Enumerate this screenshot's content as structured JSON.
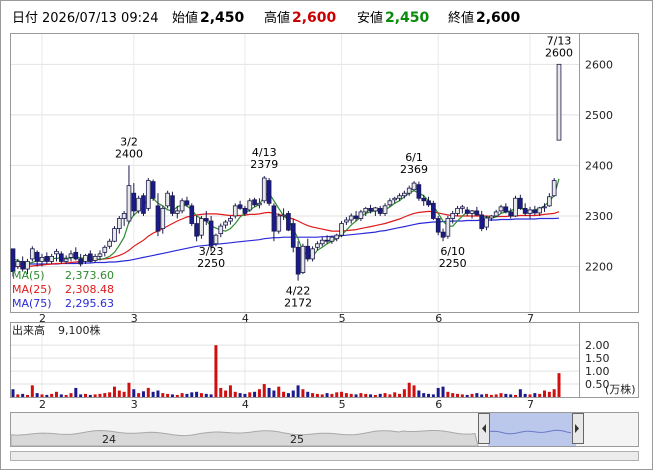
{
  "header": {
    "date_label": "日付",
    "date_value": "2026/07/13 09:24",
    "open_label": "始値",
    "open_value": "2,450",
    "high_label": "高値",
    "high_value": "2,600",
    "low_label": "安値",
    "low_value": "2,450",
    "close_label": "終値",
    "close_value": "2,600"
  },
  "colors": {
    "up": "#e8e8e8",
    "down": "#1a1a8c",
    "ma5": "#2e8b2e",
    "ma25": "#e01a1a",
    "ma75": "#2a2ad8",
    "high": "#cc0000",
    "low": "#0a8a0a",
    "vol_down": "#1a1a8c",
    "vol_up": "#d01010",
    "nav_fill": "#a8b8e8"
  },
  "legend": {
    "ma5_label": "MA(5)",
    "ma5_value": "2,373.60",
    "ma25_label": "MA(25)",
    "ma25_value": "2,308.48",
    "ma75_label": "MA(75)",
    "ma75_value": "2,295.63"
  },
  "volume_panel": {
    "label": "出来高",
    "value": "9,100株",
    "ticks": [
      "2.00",
      "1.50",
      "1.00",
      "0.50"
    ],
    "unit": "(万株)"
  },
  "navigator": {
    "labels": [
      "24",
      "25"
    ]
  },
  "chart_data": {
    "type": "candlestick",
    "x_month_ticks": [
      "2",
      "3",
      "4",
      "5",
      "6",
      "7"
    ],
    "y_ticks": [
      2200,
      2300,
      2400,
      2500,
      2600
    ],
    "ylim": [
      2110,
      2660
    ],
    "series_names": [
      "MA(5)",
      "MA(25)",
      "MA(75)"
    ],
    "annotations": [
      {
        "date": "3/2",
        "value": 2400,
        "label_date": "3/2",
        "label_value": "2400",
        "pos": "above"
      },
      {
        "date": "3/23",
        "value": 2250,
        "label_date": "3/23",
        "label_value": "2250",
        "pos": "below"
      },
      {
        "date": "4/13",
        "value": 2379,
        "label_date": "4/13",
        "label_value": "2379",
        "pos": "above"
      },
      {
        "date": "4/22",
        "value": 2172,
        "label_date": "4/22",
        "label_value": "2172",
        "pos": "below"
      },
      {
        "date": "6/1",
        "value": 2369,
        "label_date": "6/1",
        "label_value": "2369",
        "pos": "above"
      },
      {
        "date": "6/10",
        "value": 2250,
        "label_date": "6/10",
        "label_value": "2250",
        "pos": "below"
      },
      {
        "date": "7/13",
        "value": 2600,
        "label_date": "7/13",
        "label_value": "2600",
        "pos": "above"
      }
    ],
    "candles": [
      [
        2235,
        2235,
        2180,
        2190
      ],
      [
        2200,
        2215,
        2195,
        2210
      ],
      [
        2210,
        2220,
        2190,
        2195
      ],
      [
        2195,
        2215,
        2185,
        2210
      ],
      [
        2215,
        2240,
        2210,
        2235
      ],
      [
        2228,
        2232,
        2200,
        2210
      ],
      [
        2210,
        2225,
        2200,
        2218
      ],
      [
        2220,
        2228,
        2205,
        2210
      ],
      [
        2210,
        2225,
        2205,
        2220
      ],
      [
        2225,
        2235,
        2210,
        2230
      ],
      [
        2225,
        2230,
        2205,
        2210
      ],
      [
        2210,
        2222,
        2205,
        2215
      ],
      [
        2218,
        2232,
        2210,
        2225
      ],
      [
        2228,
        2238,
        2212,
        2215
      ],
      [
        2215,
        2225,
        2200,
        2205
      ],
      [
        2210,
        2225,
        2205,
        2222
      ],
      [
        2225,
        2232,
        2208,
        2210
      ],
      [
        2212,
        2225,
        2208,
        2220
      ],
      [
        2220,
        2232,
        2212,
        2225
      ],
      [
        2228,
        2242,
        2220,
        2238
      ],
      [
        2240,
        2255,
        2235,
        2250
      ],
      [
        2250,
        2280,
        2248,
        2275
      ],
      [
        2275,
        2300,
        2265,
        2295
      ],
      [
        2295,
        2310,
        2280,
        2305
      ],
      [
        2290,
        2400,
        2285,
        2360
      ],
      [
        2345,
        2365,
        2300,
        2310
      ],
      [
        2310,
        2340,
        2305,
        2335
      ],
      [
        2340,
        2345,
        2300,
        2305
      ],
      [
        2315,
        2375,
        2310,
        2370
      ],
      [
        2368,
        2372,
        2330,
        2335
      ],
      [
        2320,
        2345,
        2260,
        2270
      ],
      [
        2275,
        2320,
        2265,
        2315
      ],
      [
        2320,
        2350,
        2315,
        2345
      ],
      [
        2340,
        2348,
        2300,
        2305
      ],
      [
        2305,
        2320,
        2295,
        2310
      ],
      [
        2310,
        2335,
        2305,
        2330
      ],
      [
        2330,
        2338,
        2318,
        2322
      ],
      [
        2320,
        2325,
        2280,
        2285
      ],
      [
        2285,
        2300,
        2250,
        2260
      ],
      [
        2262,
        2300,
        2255,
        2295
      ],
      [
        2295,
        2310,
        2282,
        2290
      ],
      [
        2290,
        2300,
        2230,
        2240
      ],
      [
        2245,
        2265,
        2240,
        2262
      ],
      [
        2265,
        2285,
        2258,
        2280
      ],
      [
        2282,
        2292,
        2275,
        2288
      ],
      [
        2290,
        2300,
        2283,
        2295
      ],
      [
        2300,
        2325,
        2295,
        2320
      ],
      [
        2322,
        2330,
        2312,
        2315
      ],
      [
        2315,
        2320,
        2300,
        2305
      ],
      [
        2312,
        2335,
        2308,
        2330
      ],
      [
        2332,
        2336,
        2318,
        2322
      ],
      [
        2322,
        2335,
        2315,
        2325
      ],
      [
        2330,
        2379,
        2325,
        2375
      ],
      [
        2370,
        2375,
        2320,
        2325
      ],
      [
        2320,
        2325,
        2250,
        2270
      ],
      [
        2270,
        2305,
        2265,
        2300
      ],
      [
        2300,
        2315,
        2292,
        2302
      ],
      [
        2305,
        2310,
        2270,
        2272
      ],
      [
        2285,
        2295,
        2228,
        2238
      ],
      [
        2238,
        2250,
        2172,
        2185
      ],
      [
        2188,
        2245,
        2185,
        2240
      ],
      [
        2240,
        2255,
        2210,
        2215
      ],
      [
        2215,
        2240,
        2210,
        2235
      ],
      [
        2238,
        2250,
        2232,
        2245
      ],
      [
        2245,
        2258,
        2240,
        2252
      ],
      [
        2252,
        2262,
        2245,
        2250
      ],
      [
        2250,
        2260,
        2245,
        2258
      ],
      [
        2255,
        2265,
        2250,
        2262
      ],
      [
        2262,
        2290,
        2258,
        2285
      ],
      [
        2288,
        2298,
        2282,
        2292
      ],
      [
        2292,
        2305,
        2285,
        2300
      ],
      [
        2300,
        2310,
        2290,
        2295
      ],
      [
        2295,
        2312,
        2290,
        2308
      ],
      [
        2308,
        2318,
        2300,
        2315
      ],
      [
        2315,
        2322,
        2305,
        2310
      ],
      [
        2310,
        2318,
        2300,
        2316
      ],
      [
        2315,
        2320,
        2300,
        2305
      ],
      [
        2305,
        2325,
        2300,
        2320
      ],
      [
        2322,
        2335,
        2318,
        2330
      ],
      [
        2332,
        2338,
        2325,
        2335
      ],
      [
        2335,
        2345,
        2330,
        2340
      ],
      [
        2340,
        2350,
        2335,
        2345
      ],
      [
        2345,
        2360,
        2340,
        2355
      ],
      [
        2352,
        2369,
        2350,
        2365
      ],
      [
        2362,
        2368,
        2330,
        2335
      ],
      [
        2335,
        2342,
        2320,
        2330
      ],
      [
        2330,
        2338,
        2318,
        2322
      ],
      [
        2325,
        2330,
        2292,
        2295
      ],
      [
        2295,
        2300,
        2262,
        2268
      ],
      [
        2268,
        2275,
        2250,
        2258
      ],
      [
        2260,
        2300,
        2255,
        2295
      ],
      [
        2295,
        2310,
        2285,
        2305
      ],
      [
        2305,
        2320,
        2300,
        2315
      ],
      [
        2315,
        2322,
        2305,
        2318
      ],
      [
        2312,
        2318,
        2300,
        2305
      ],
      [
        2305,
        2312,
        2295,
        2310
      ],
      [
        2310,
        2318,
        2300,
        2302
      ],
      [
        2302,
        2310,
        2270,
        2275
      ],
      [
        2278,
        2300,
        2272,
        2296
      ],
      [
        2296,
        2302,
        2290,
        2300
      ],
      [
        2300,
        2312,
        2298,
        2308
      ],
      [
        2310,
        2322,
        2305,
        2318
      ],
      [
        2318,
        2325,
        2305,
        2308
      ],
      [
        2308,
        2315,
        2295,
        2300
      ],
      [
        2300,
        2340,
        2298,
        2335
      ],
      [
        2335,
        2342,
        2312,
        2315
      ],
      [
        2315,
        2325,
        2300,
        2305
      ],
      [
        2305,
        2318,
        2295,
        2312
      ],
      [
        2312,
        2320,
        2302,
        2306
      ],
      [
        2306,
        2318,
        2300,
        2316
      ],
      [
        2316,
        2325,
        2308,
        2318
      ],
      [
        2320,
        2345,
        2318,
        2338
      ],
      [
        2340,
        2375,
        2338,
        2370
      ],
      [
        2450,
        2600,
        2450,
        2600
      ]
    ],
    "volume": [
      0.3,
      0.1,
      0.12,
      0.08,
      0.45,
      0.15,
      0.1,
      0.08,
      0.12,
      0.2,
      0.1,
      0.08,
      0.15,
      0.35,
      0.1,
      0.12,
      0.08,
      0.1,
      0.12,
      0.15,
      0.18,
      0.4,
      0.25,
      0.2,
      0.55,
      0.3,
      0.15,
      0.22,
      0.35,
      0.2,
      0.25,
      0.15,
      0.12,
      0.1,
      0.08,
      0.15,
      0.12,
      0.18,
      0.2,
      0.15,
      0.12,
      0.1,
      2.0,
      0.35,
      0.25,
      0.45,
      0.2,
      0.15,
      0.12,
      0.18,
      0.2,
      0.3,
      0.5,
      0.35,
      0.25,
      0.4,
      0.2,
      0.15,
      0.25,
      0.45,
      0.3,
      0.2,
      0.15,
      0.12,
      0.1,
      0.15,
      0.12,
      0.18,
      0.2,
      0.15,
      0.12,
      0.1,
      0.15,
      0.12,
      0.1,
      0.08,
      0.12,
      0.15,
      0.1,
      0.18,
      0.12,
      0.3,
      0.55,
      0.45,
      0.25,
      0.15,
      0.12,
      0.1,
      0.35,
      0.4,
      0.2,
      0.15,
      0.12,
      0.1,
      0.08,
      0.12,
      0.15,
      0.1,
      0.12,
      0.08,
      0.1,
      0.15,
      0.12,
      0.1,
      0.08,
      0.3,
      0.12,
      0.1,
      0.15,
      0.12,
      0.25,
      0.2,
      0.3,
      0.92
    ],
    "ma5": [
      2215,
      2212,
      2208,
      2206,
      2208,
      2212,
      2213,
      2214,
      2216,
      2216,
      2217,
      2216,
      2217,
      2219,
      2217,
      2216,
      2215,
      2215,
      2214,
      2216,
      2220,
      2228,
      2242,
      2258,
      2288,
      2302,
      2310,
      2320,
      2335,
      2335,
      2325,
      2320,
      2312,
      2310,
      2318,
      2322,
      2320,
      2312,
      2300,
      2295,
      2290,
      2280,
      2276,
      2272,
      2270,
      2275,
      2285,
      2298,
      2305,
      2312,
      2318,
      2322,
      2340,
      2345,
      2330,
      2315,
      2300,
      2292,
      2275,
      2255,
      2230,
      2222,
      2220,
      2232,
      2238,
      2245,
      2250,
      2255,
      2262,
      2272,
      2282,
      2290,
      2298,
      2305,
      2308,
      2310,
      2310,
      2312,
      2318,
      2325,
      2330,
      2338,
      2345,
      2350,
      2345,
      2340,
      2330,
      2320,
      2305,
      2290,
      2280,
      2280,
      2290,
      2300,
      2308,
      2308,
      2305,
      2300,
      2298,
      2296,
      2298,
      2305,
      2308,
      2310,
      2315,
      2315,
      2312,
      2310,
      2312,
      2315,
      2320,
      2330,
      2340,
      2373.6
    ],
    "ma25": [
      2200,
      2200,
      2200,
      2200,
      2201,
      2202,
      2203,
      2204,
      2205,
      2206,
      2206,
      2207,
      2208,
      2209,
      2210,
      2211,
      2212,
      2213,
      2214,
      2215,
      2216,
      2219,
      2222,
      2226,
      2232,
      2240,
      2246,
      2252,
      2260,
      2266,
      2270,
      2275,
      2280,
      2285,
      2290,
      2294,
      2298,
      2300,
      2302,
      2303,
      2304,
      2304,
      2304,
      2303,
      2302,
      2301,
      2301,
      2301,
      2302,
      2303,
      2303,
      2304,
      2306,
      2307,
      2305,
      2303,
      2300,
      2297,
      2294,
      2290,
      2285,
      2281,
      2278,
      2276,
      2274,
      2272,
      2270,
      2270,
      2270,
      2271,
      2272,
      2273,
      2275,
      2277,
      2279,
      2281,
      2283,
      2285,
      2288,
      2291,
      2294,
      2298,
      2302,
      2305,
      2307,
      2308,
      2309,
      2308,
      2306,
      2304,
      2302,
      2301,
      2300,
      2300,
      2300,
      2300,
      2300,
      2300,
      2300,
      2299,
      2299,
      2299,
      2299,
      2300,
      2300,
      2301,
      2301,
      2301,
      2301,
      2302,
      2303,
      2304,
      2305,
      2308.48
    ],
    "ma75": [
      2205,
      2205,
      2205,
      2205,
      2205,
      2205,
      2205,
      2205,
      2205,
      2205,
      2206,
      2206,
      2206,
      2206,
      2207,
      2207,
      2207,
      2208,
      2208,
      2208,
      2209,
      2209,
      2210,
      2211,
      2212,
      2214,
      2216,
      2218,
      2220,
      2222,
      2224,
      2226,
      2228,
      2230,
      2232,
      2234,
      2236,
      2238,
      2240,
      2241,
      2242,
      2243,
      2244,
      2245,
      2246,
      2247,
      2248,
      2249,
      2250,
      2251,
      2252,
      2253,
      2255,
      2256,
      2257,
      2257,
      2258,
      2258,
      2258,
      2258,
      2258,
      2258,
      2258,
      2258,
      2259,
      2259,
      2260,
      2260,
      2261,
      2262,
      2263,
      2264,
      2265,
      2266,
      2267,
      2268,
      2270,
      2271,
      2273,
      2275,
      2277,
      2279,
      2281,
      2283,
      2285,
      2286,
      2287,
      2288,
      2288,
      2289,
      2289,
      2290,
      2290,
      2290,
      2291,
      2291,
      2291,
      2292,
      2292,
      2292,
      2292,
      2293,
      2293,
      2293,
      2294,
      2294,
      2294,
      2294,
      2294,
      2295,
      2295,
      2295,
      2295,
      2295.63
    ]
  }
}
